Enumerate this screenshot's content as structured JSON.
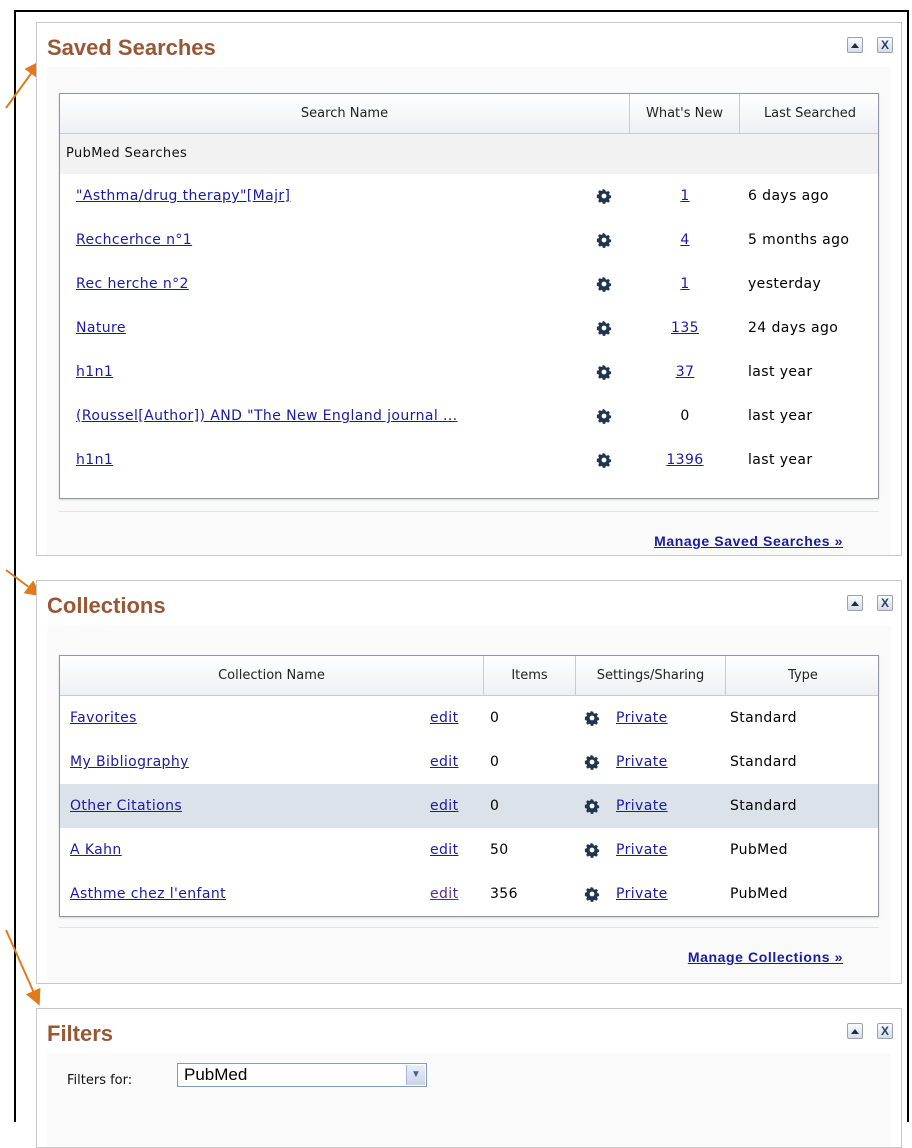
{
  "saved_searches": {
    "title": "Saved Searches",
    "columns": {
      "name": "Search Name",
      "whats_new": "What's New",
      "last_searched": "Last Searched"
    },
    "group_label": "PubMed Searches",
    "rows": [
      {
        "name": "\"Asthma/drug therapy\"[Majr]",
        "whats_new": "1",
        "last": "6 days ago"
      },
      {
        "name": "Rechcerhce n°1",
        "whats_new": "4",
        "last": "5 months ago"
      },
      {
        "name": "Rec herche n°2",
        "whats_new": "1",
        "last": "yesterday"
      },
      {
        "name": "Nature",
        "whats_new": "135",
        "last": "24 days ago"
      },
      {
        "name": "h1n1",
        "whats_new": "37",
        "last": "last year"
      },
      {
        "name": "(Roussel[Author]) AND \"The New England journal ...",
        "whats_new": "0",
        "last": "last year"
      },
      {
        "name": "h1n1",
        "whats_new": "1396",
        "last": "last year"
      }
    ],
    "manage_link": "Manage Saved Searches »"
  },
  "collections": {
    "title": "Collections",
    "columns": {
      "name": "Collection Name",
      "items": "Items",
      "settings": "Settings/Sharing",
      "type": "Type"
    },
    "rows": [
      {
        "name": "Favorites",
        "edit": "edit",
        "items": "0",
        "privacy": "Private",
        "type": "Standard"
      },
      {
        "name": "My Bibliography",
        "edit": "edit",
        "items": "0",
        "privacy": "Private",
        "type": "Standard"
      },
      {
        "name": "Other Citations",
        "edit": "edit",
        "items": "0",
        "privacy": "Private",
        "type": "Standard"
      },
      {
        "name": "A Kahn",
        "edit": "edit",
        "items": "50",
        "privacy": "Private",
        "type": "PubMed"
      },
      {
        "name": "Asthme chez l'enfant",
        "edit": "edit",
        "items": "356",
        "privacy": "Private",
        "type": "PubMed"
      }
    ],
    "manage_link": "Manage Collections »"
  },
  "filters": {
    "title": "Filters",
    "label": "Filters for:",
    "selected": "PubMed"
  },
  "panel_buttons": {
    "close": "X"
  },
  "colors": {
    "title": "#985735",
    "link": "#1a1aa6",
    "arrow": "#e07a1a"
  }
}
